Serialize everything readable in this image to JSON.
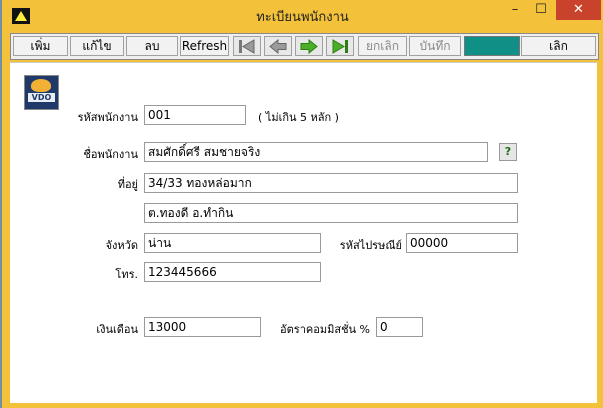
{
  "window": {
    "title": "ทะเบียนพนักงาน",
    "controls": {
      "minimize": "–",
      "maximize": "☐",
      "close": "✕"
    }
  },
  "toolbar": {
    "add_label": "เพิ่ม",
    "edit_label": "แก้ไข",
    "delete_label": "ลบ",
    "refresh_label": "Refresh",
    "cancel_label": "ยกเลิก",
    "save_label": "บันทึก",
    "exit_label": "เลิก",
    "teal_color": "#0f8f86"
  },
  "logo": {
    "text": "VDO"
  },
  "form": {
    "emp_id": {
      "label": "รหัสพนักงาน",
      "value": "001",
      "hint": "( ไม่เกิน 5 หลัก )"
    },
    "name": {
      "label": "ชื่อพนักงาน",
      "value": "สมศักดิ์ศรี สมชายจริง",
      "lookup": "?"
    },
    "address": {
      "label": "ที่อยู่",
      "line1": "34/33 ทองหล่อมาก",
      "line2": "ต.ทองดี  อ.ทำกิน"
    },
    "province": {
      "label": "จังหวัด",
      "value": "น่าน"
    },
    "zip": {
      "label": "รหัสไปรษณีย์",
      "value": "00000"
    },
    "phone": {
      "label": "โทร.",
      "value": "123445666"
    },
    "salary": {
      "label": "เงินเดือน",
      "value": "13000"
    },
    "commission": {
      "label": "อัตราคอมมิสชั่น %",
      "value": "0"
    }
  }
}
